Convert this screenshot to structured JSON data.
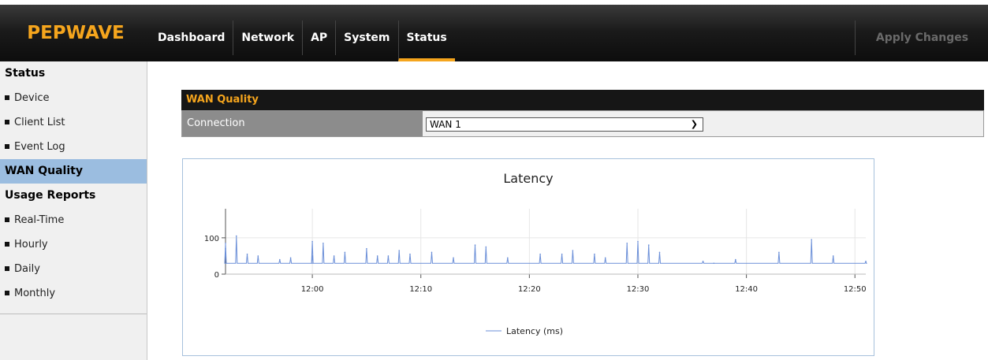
{
  "app": {
    "logo_text": "PEPWAVE"
  },
  "nav": {
    "items": [
      {
        "label": "Dashboard"
      },
      {
        "label": "Network"
      },
      {
        "label": "AP"
      },
      {
        "label": "System"
      },
      {
        "label": "Status",
        "active": true
      }
    ],
    "apply_label": "Apply Changes"
  },
  "sidebar": {
    "status_header": "Status",
    "status_items": [
      "Device",
      "Client List",
      "Event Log"
    ],
    "wan_quality": "WAN Quality",
    "usage_header": "Usage Reports",
    "usage_items": [
      "Real-Time",
      "Hourly",
      "Daily",
      "Monthly"
    ]
  },
  "main": {
    "section_title": "WAN Quality",
    "connection_label": "Connection",
    "connection_value": "WAN 1"
  },
  "colors": {
    "accent": "#f5a51d",
    "sidebar_active": "#9bbde0",
    "series": "#6b8fd8"
  },
  "chart_data": {
    "type": "line",
    "title": "Latency",
    "xlabel": "",
    "ylabel": "",
    "x_range": [
      "11:52",
      "12:51"
    ],
    "ylim": [
      0,
      180
    ],
    "y_ticks": [
      0,
      100
    ],
    "x_ticks": [
      "12:00",
      "12:10",
      "12:20",
      "12:30",
      "12:40",
      "12:50"
    ],
    "grid": true,
    "legend": "bottom",
    "series": [
      {
        "name": "Latency (ms)",
        "baseline": 30,
        "x": [
          "11:52",
          "11:52",
          "11:53",
          "11:54",
          "11:55",
          "11:57",
          "11:58",
          "12:00",
          "12:00",
          "12:01",
          "12:02",
          "12:03",
          "12:05",
          "12:06",
          "12:07",
          "12:08",
          "12:09",
          "12:11",
          "12:13",
          "12:15",
          "12:16",
          "12:18",
          "12:21",
          "12:23",
          "12:24",
          "12:26",
          "12:27",
          "12:29",
          "12:30",
          "12:31",
          "12:32",
          "12:36",
          "12:37",
          "12:39",
          "12:43",
          "12:46",
          "12:48",
          "12:51"
        ],
        "values": [
          70,
          85,
          105,
          55,
          50,
          40,
          45,
          50,
          90,
          85,
          50,
          60,
          70,
          50,
          50,
          65,
          55,
          60,
          45,
          80,
          75,
          45,
          55,
          55,
          65,
          55,
          45,
          85,
          90,
          80,
          60,
          35,
          30,
          40,
          60,
          95,
          50,
          35
        ]
      }
    ]
  }
}
